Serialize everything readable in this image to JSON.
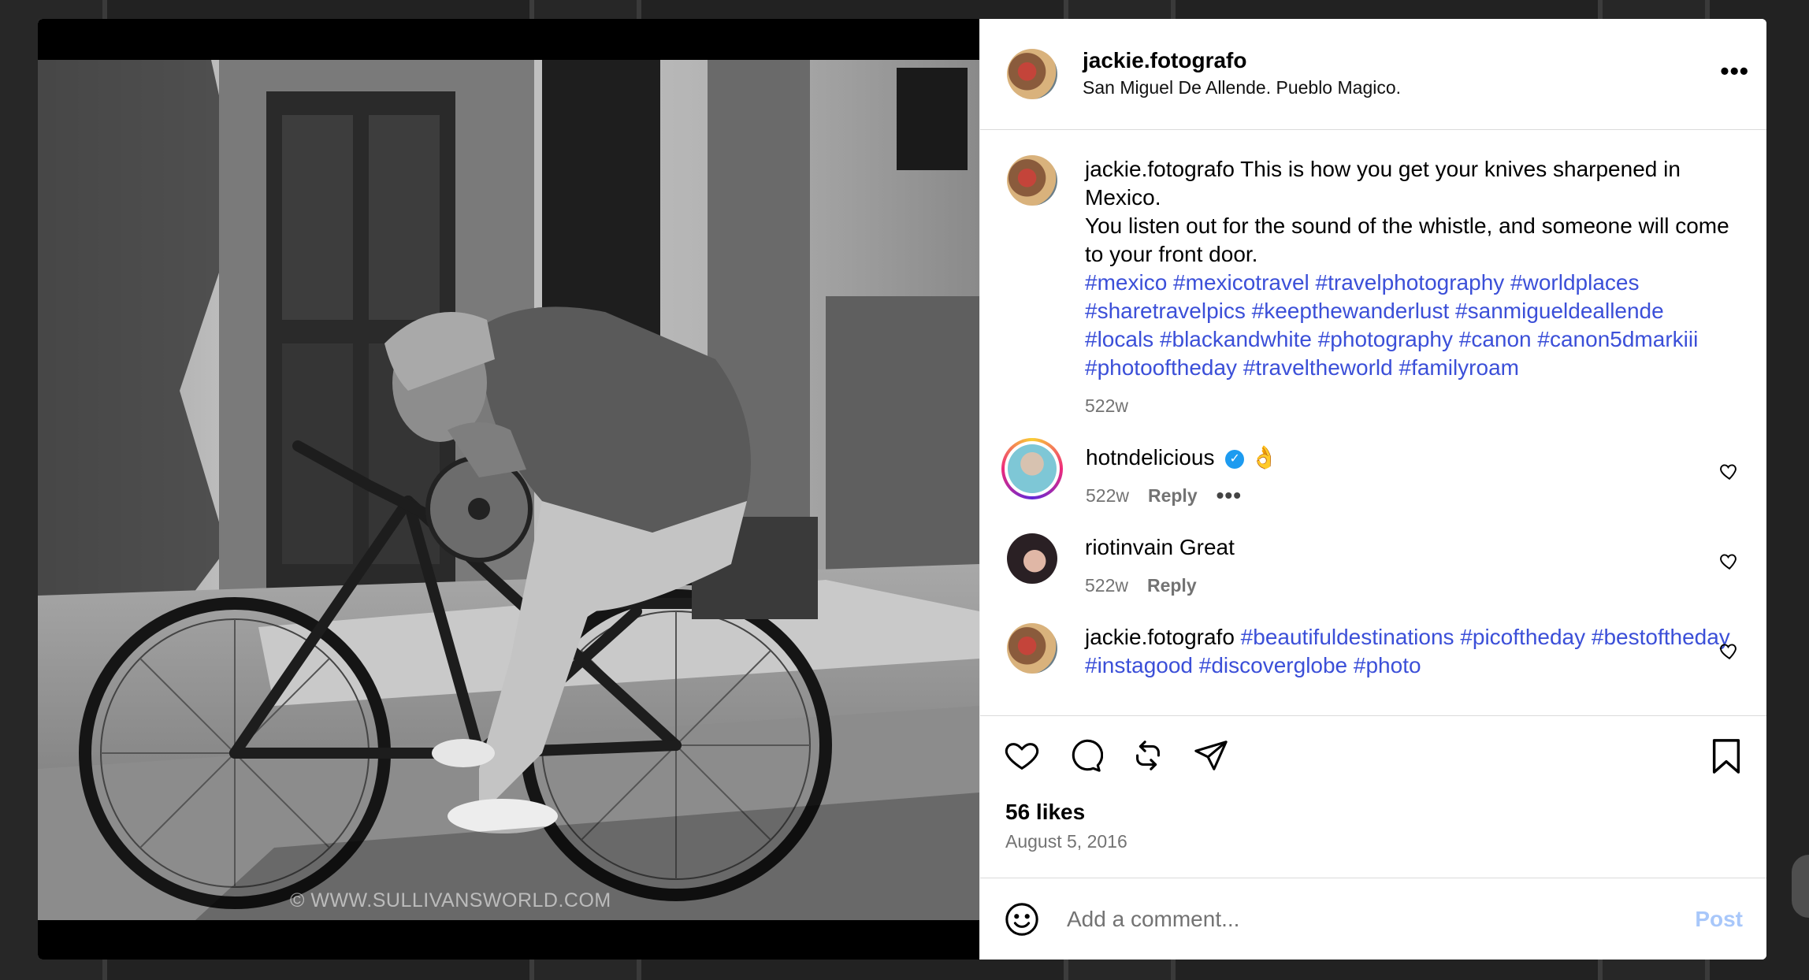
{
  "post": {
    "username": "jackie.fotografo",
    "location": "San Miguel De Allende. Pueblo Magico.",
    "more_label": "•••",
    "watermark": "© WWW.SULLIVANSWORLD.COM"
  },
  "caption": {
    "user": "jackie.fotografo",
    "text1": "This is how you get your knives sharpened in Mexico.",
    "text2": "You listen out for the sound of the whistle, and someone will come to your front door.",
    "hashtags": "#mexico #mexicotravel #travelphotography #worldplaces #sharetravelpics #keepthewanderlust #sanmigueldeallende #locals #blackandwhite #photography #canon #canon5dmarkiii #photooftheday #traveltheworld #familyroam",
    "time": "522w"
  },
  "comments": [
    {
      "user": "hotndelicious",
      "verified_icon": "verified-badge",
      "text": "👌",
      "time": "522w",
      "reply": "Reply",
      "more": "•••"
    },
    {
      "user": "riotinvain",
      "text": "Great",
      "time": "522w",
      "reply": "Reply"
    },
    {
      "user": "jackie.fotografo",
      "hashtags": "#beautifuldestinations #picoftheday #bestoftheday #instagood #discoverglobe #photo"
    }
  ],
  "footer": {
    "likes": "56 likes",
    "date": "August 5, 2016",
    "comment_placeholder": "Add a comment...",
    "post_label": "Post"
  },
  "colors": {
    "hashtag": "#3b4fd8",
    "post_button": "#a8c7fa",
    "meta": "#737373"
  }
}
